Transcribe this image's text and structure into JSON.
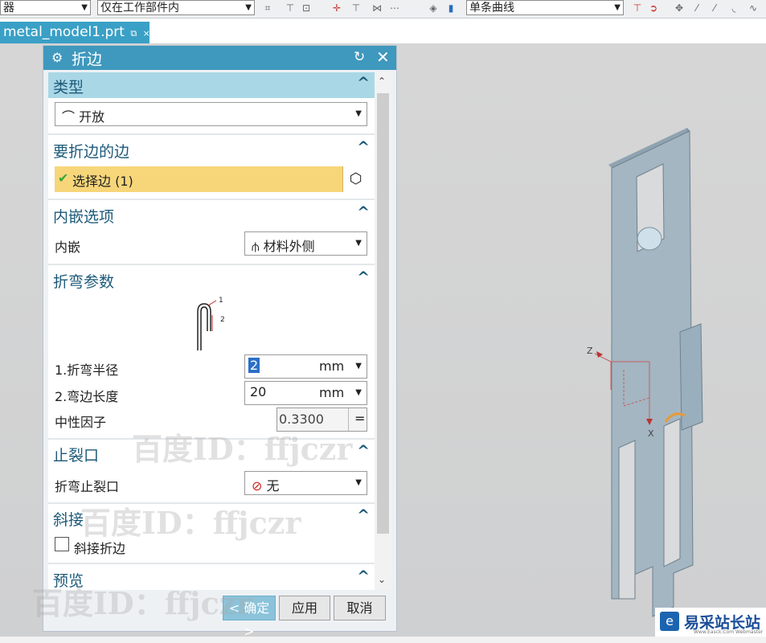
{
  "toolbar": {
    "filter_select": "器",
    "scope_select": "仅在工作部件内",
    "curve_select": "单条曲线"
  },
  "tab": {
    "filename": "metal_model1.prt",
    "close": "×"
  },
  "dialog": {
    "title": "折边",
    "sections": {
      "type": {
        "header": "类型",
        "value": "开放"
      },
      "edge": {
        "header": "要折边的边",
        "select_label": "选择边 (1)"
      },
      "inset": {
        "header": "内嵌选项",
        "label": "内嵌",
        "value": "材料外侧"
      },
      "bend": {
        "header": "折弯参数",
        "diagram_label_1": "1",
        "diagram_label_2": "2",
        "radius_label": "1.折弯半径",
        "radius_value": "2",
        "radius_unit": "mm",
        "length_label": "2.弯边长度",
        "length_value": "20",
        "length_unit": "mm",
        "kfactor_label": "中性因子",
        "kfactor_value": "0.3300",
        "kfactor_eq": "="
      },
      "relief": {
        "header": "止裂口",
        "label": "折弯止裂口",
        "value": "无"
      },
      "miter": {
        "header": "斜接",
        "checkbox_label": "斜接折边",
        "checked": false
      },
      "preview": {
        "header": "预览"
      }
    },
    "buttons": {
      "ok": "< 确定 >",
      "apply": "应用",
      "cancel": "取消"
    }
  },
  "viewport": {
    "axis_z": "Z",
    "axis_x": "X"
  },
  "watermark": {
    "text": "百度ID：ffjczr"
  },
  "logo": {
    "name": "易采站长站",
    "sub": "Www.Easck.Com Webmaster"
  }
}
